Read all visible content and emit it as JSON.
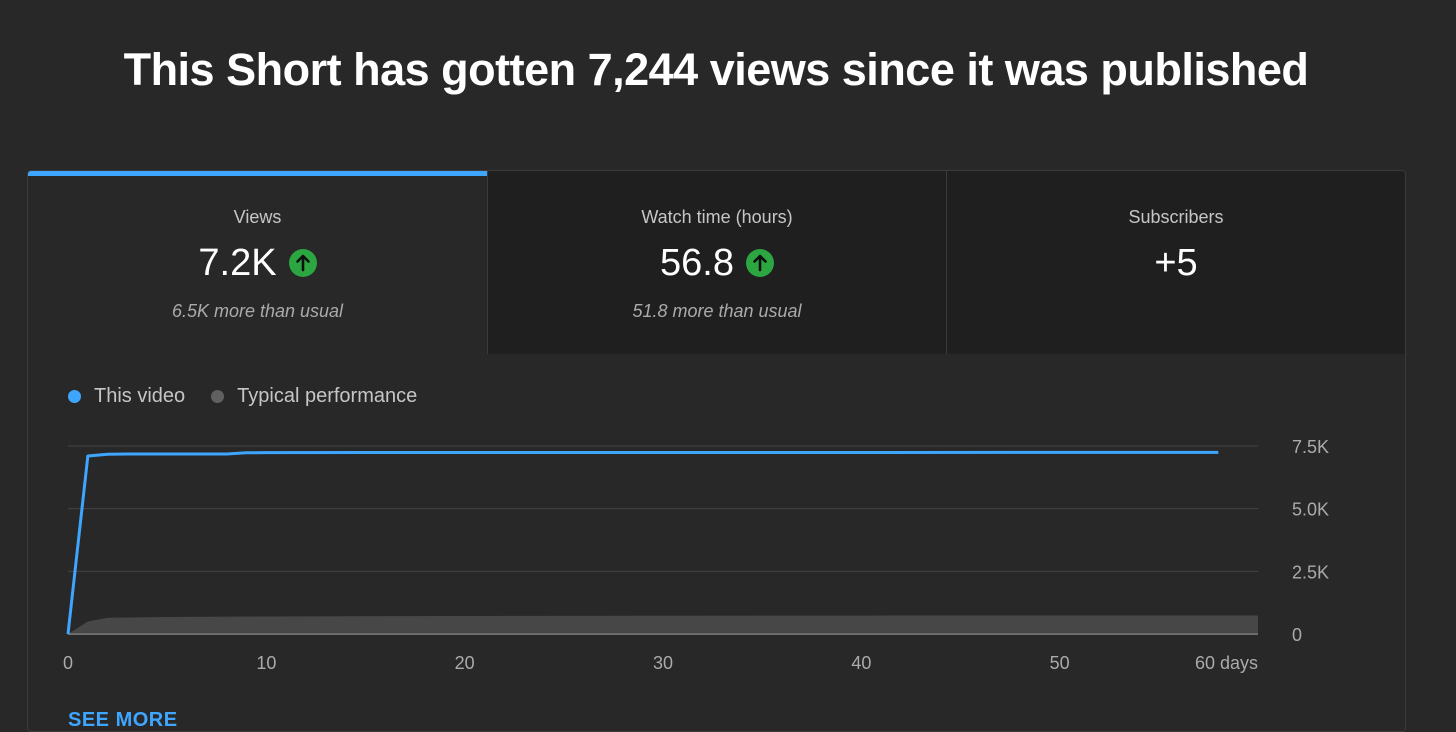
{
  "page": {
    "title": "This Short has gotten 7,244 views since it was published"
  },
  "tabs": [
    {
      "label": "Views",
      "value": "7.2K",
      "trend": "up",
      "note": "6.5K more than usual",
      "active": true
    },
    {
      "label": "Watch time (hours)",
      "value": "56.8",
      "trend": "up",
      "note": "51.8 more than usual",
      "active": false
    },
    {
      "label": "Subscribers",
      "value": "+5",
      "trend": "",
      "note": "",
      "active": false
    }
  ],
  "legend": {
    "this_video": "This video",
    "typical": "Typical performance"
  },
  "colors": {
    "accent": "#3ea6ff",
    "this_video": "#3ea6ff",
    "typical": "#606060",
    "trend_up": "#2ba640"
  },
  "chart_data": {
    "type": "line",
    "xlabel": "",
    "ylabel": "",
    "x_ticks": [
      "0",
      "10",
      "20",
      "30",
      "40",
      "50",
      "60 days"
    ],
    "y_ticks": [
      "0",
      "2.5K",
      "5.0K",
      "7.5K"
    ],
    "xlim": [
      0,
      60
    ],
    "ylim": [
      0,
      7500
    ],
    "grid": true,
    "legend_position": "top-left",
    "series": [
      {
        "name": "This video",
        "x": [
          0,
          1,
          2,
          3,
          4,
          5,
          6,
          7,
          8,
          9,
          10,
          15,
          20,
          30,
          40,
          50,
          58
        ],
        "y": [
          0,
          7100,
          7170,
          7180,
          7180,
          7180,
          7180,
          7180,
          7180,
          7230,
          7235,
          7240,
          7240,
          7242,
          7243,
          7244,
          7244
        ]
      },
      {
        "name": "Typical performance",
        "x": [
          0,
          1,
          2,
          5,
          10,
          20,
          30,
          40,
          50,
          60
        ],
        "y": [
          0,
          500,
          650,
          680,
          700,
          720,
          730,
          735,
          740,
          740
        ]
      }
    ]
  },
  "see_more": "SEE MORE"
}
